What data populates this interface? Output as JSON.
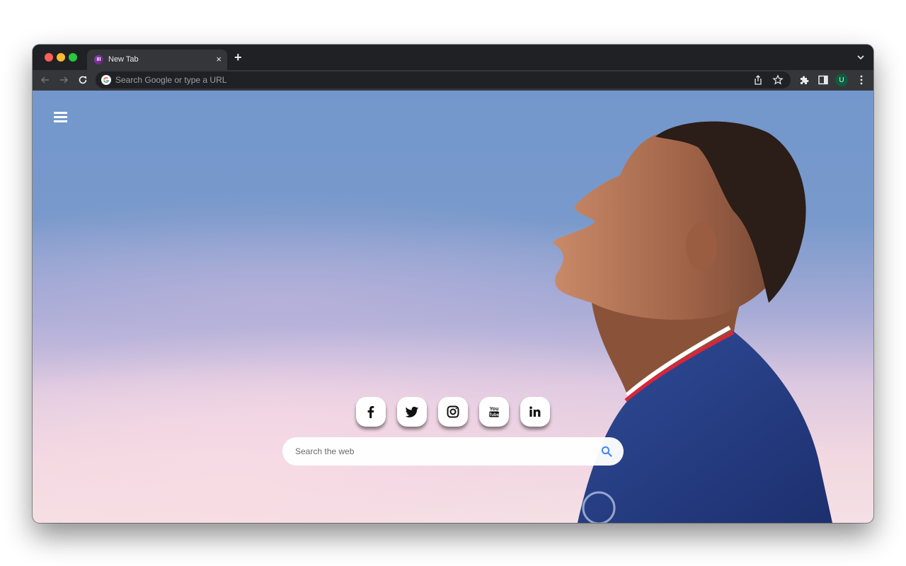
{
  "browser": {
    "tab": {
      "title": "New Tab",
      "favicon": "ui-extension-favicon",
      "close_label": "×"
    },
    "new_tab_label": "+",
    "omnibox": {
      "placeholder": "Search Google or type a URL",
      "value": ""
    },
    "profile": {
      "initial": "U",
      "color": "#0d5c3e"
    },
    "icons": [
      "back-arrow-icon",
      "forward-arrow-icon",
      "reload-icon",
      "google-icon",
      "share-icon",
      "bookmark-star-icon",
      "extensions-puzzle-icon",
      "side-panel-icon",
      "more-vert-icon",
      "tab-search-chevron-icon"
    ]
  },
  "page": {
    "menu_icon": "hamburger-icon",
    "background": "sky-photo-with-football-player-in-blue-jersey",
    "social_links": [
      {
        "name": "Facebook",
        "icon": "facebook-icon"
      },
      {
        "name": "Twitter",
        "icon": "twitter-icon"
      },
      {
        "name": "Instagram",
        "icon": "instagram-icon"
      },
      {
        "name": "YouTube",
        "icon": "youtube-icon"
      },
      {
        "name": "LinkedIn",
        "icon": "linkedin-icon"
      }
    ],
    "search": {
      "placeholder": "Search the web",
      "value": "",
      "accent": "#4285f4"
    }
  }
}
